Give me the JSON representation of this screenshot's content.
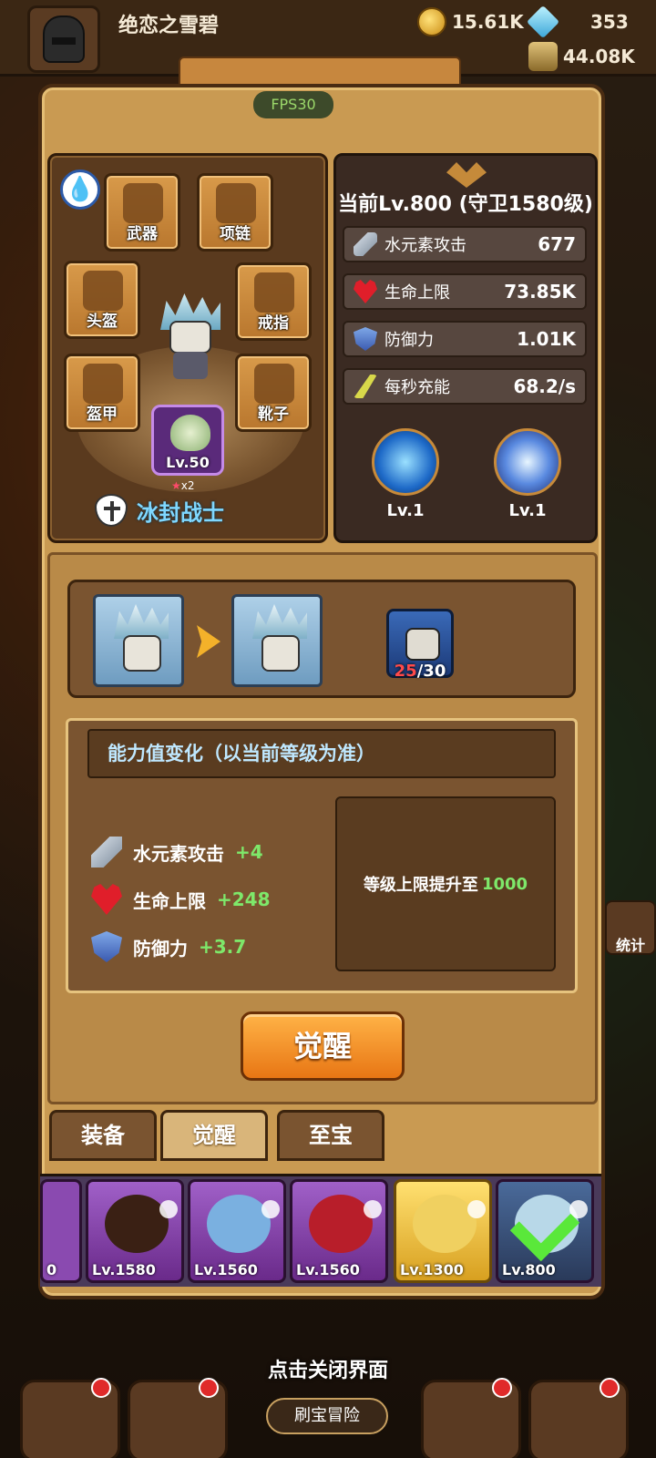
{
  "player": {
    "name": "绝恋之雪碧",
    "gold": "15.61K",
    "gems": "353",
    "jars": "44.08K"
  },
  "fps": "FPS30",
  "character": {
    "class_name": "冰封战士",
    "pet_level": "Lv.50",
    "pet_stars": "x2",
    "slots": {
      "weapon": "武器",
      "necklace": "项链",
      "helmet": "头盔",
      "ring": "戒指",
      "armor": "盔甲",
      "boots": "靴子"
    }
  },
  "stats": {
    "current_level": "当前Lv.800 (守卫1580级)",
    "rows": [
      {
        "name": "水元素攻击",
        "value": "677"
      },
      {
        "name": "生命上限",
        "value": "73.85K"
      },
      {
        "name": "防御力",
        "value": "1.01K"
      },
      {
        "name": "每秒充能",
        "value": "68.2/s"
      }
    ],
    "skills": [
      {
        "icon": "shield-skill-icon",
        "level": "Lv.1"
      },
      {
        "icon": "snowflake-skill-icon",
        "level": "Lv.1"
      }
    ]
  },
  "awaken": {
    "shard_current": "25",
    "shard_total": "/30",
    "change_title": "能力值变化（以当前等级为准）",
    "changes": [
      {
        "name": "水元素攻击",
        "delta": "+4"
      },
      {
        "name": "生命上限",
        "delta": "+248"
      },
      {
        "name": "防御力",
        "delta": "+3.7"
      }
    ],
    "cap_text": "等级上限提升至",
    "cap_value": "1000",
    "button": "觉醒"
  },
  "tabs": [
    {
      "label": "装备"
    },
    {
      "label": "觉醒",
      "active": true
    },
    {
      "label": "至宝"
    }
  ],
  "roster": [
    {
      "level": "0"
    },
    {
      "level": "Lv.1580"
    },
    {
      "level": "Lv.1560"
    },
    {
      "level": "Lv.1560"
    },
    {
      "level": "Lv.1300"
    },
    {
      "level": "Lv.800",
      "selected": true
    }
  ],
  "close_hint": "点击关闭界面",
  "bottom_nav": {
    "explore": "刷宝冒险",
    "side_stats": "统计"
  },
  "colors": {
    "panel": "#c99a52",
    "class_name": "#7fd8ff",
    "bonus_green": "#7ee86a",
    "awaken_button": "#e87614"
  }
}
